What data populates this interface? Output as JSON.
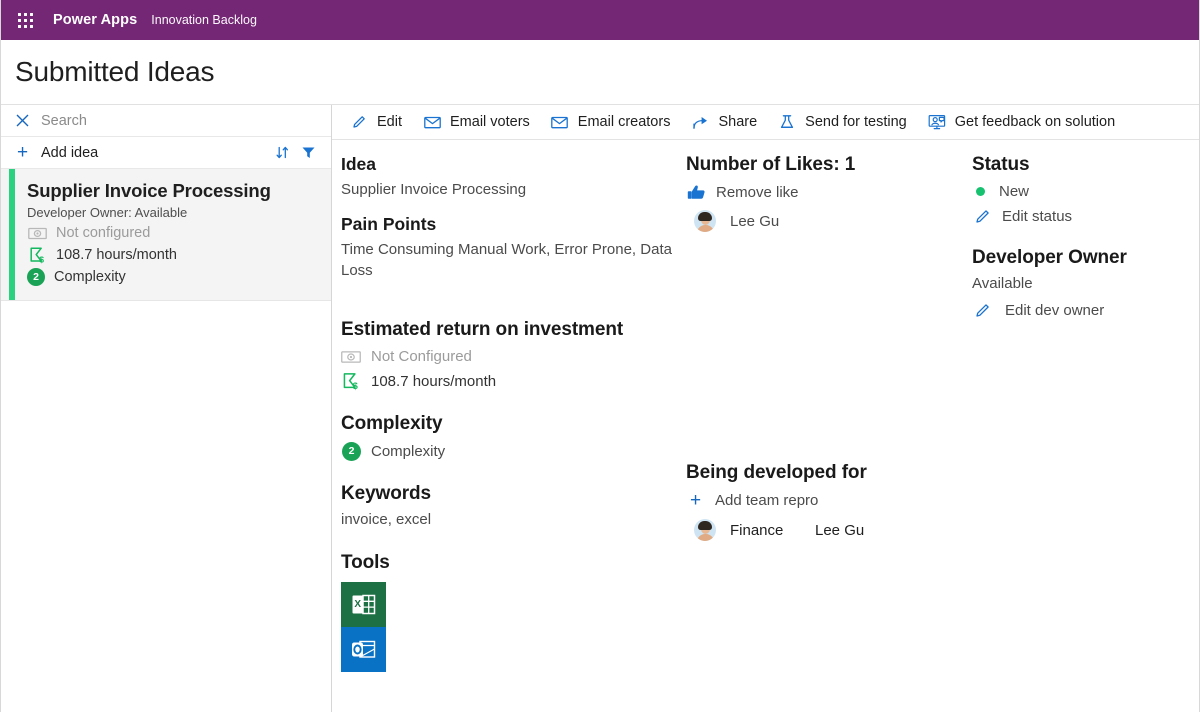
{
  "suite_bar": {
    "waffle_icon": "waffle-grid-icon",
    "brand": "Power Apps",
    "app_name": "Innovation Backlog",
    "background_color": "#742774"
  },
  "page": {
    "title": "Submitted Ideas"
  },
  "left_pane": {
    "search": {
      "icon": "close-x-icon",
      "placeholder": "Search",
      "value": ""
    },
    "add_idea": {
      "icon": "plus-icon",
      "label": "Add idea"
    },
    "sort_icon": "sort-ascending-descending-icon",
    "filter_icon": "filter-funnel-icon",
    "items": [
      {
        "title": "Supplier Invoice Processing",
        "subtitle": "Developer Owner: Available",
        "roi_money": "Not configured",
        "roi_money_icon": "money-bill-icon",
        "roi_hours": "108.7 hours/month",
        "roi_hours_icon": "hourglass-dollar-icon",
        "complexity_badge": "2",
        "complexity_label": "Complexity",
        "accent_color": "#2ad17e",
        "selected": true
      }
    ]
  },
  "command_bar": {
    "buttons": [
      {
        "label": "Edit",
        "icon": "pencil-icon"
      },
      {
        "label": "Email voters",
        "icon": "envelope-icon"
      },
      {
        "label": "Email creators",
        "icon": "envelope-icon"
      },
      {
        "label": "Share",
        "icon": "share-arrow-icon"
      },
      {
        "label": "Send for testing",
        "icon": "flask-icon"
      },
      {
        "label": "Get feedback on solution",
        "icon": "feedback-person-icon"
      }
    ]
  },
  "detail": {
    "idea": {
      "heading": "Idea",
      "value": "Supplier Invoice Processing"
    },
    "pain_points": {
      "heading": "Pain Points",
      "value": "Time Consuming Manual Work, Error Prone, Data Loss"
    },
    "roi": {
      "heading": "Estimated return on investment",
      "money_icon": "money-bill-icon",
      "money_value": "Not Configured",
      "hours_icon": "hourglass-dollar-icon",
      "hours_value": "108.7 hours/month"
    },
    "complexity": {
      "heading": "Complexity",
      "badge": "2",
      "label": "Complexity"
    },
    "keywords": {
      "heading": "Keywords",
      "value": "invoice, excel"
    },
    "tools": {
      "heading": "Tools",
      "items": [
        {
          "name": "excel-tool-icon",
          "label": "Excel",
          "color": "#1c7044"
        },
        {
          "name": "outlook-tool-icon",
          "label": "Outlook",
          "color": "#0a72c5"
        }
      ]
    },
    "likes": {
      "heading": "Number of Likes: 1",
      "action_icon": "thumbs-up-icon",
      "action_label": "Remove like",
      "voters": [
        {
          "name": "Lee Gu"
        }
      ]
    },
    "developed_for": {
      "heading": "Being developed for",
      "add_icon": "plus-icon",
      "add_label": "Add team repro",
      "rows": [
        {
          "team": "Finance",
          "person": "Lee Gu"
        }
      ]
    },
    "status": {
      "heading": "Status",
      "dot_color": "#16c270",
      "value": "New",
      "edit_icon": "pencil-icon",
      "edit_label": "Edit status"
    },
    "developer_owner": {
      "heading": "Developer Owner",
      "value": "Available",
      "edit_icon": "pencil-icon",
      "edit_label": "Edit dev owner"
    }
  }
}
